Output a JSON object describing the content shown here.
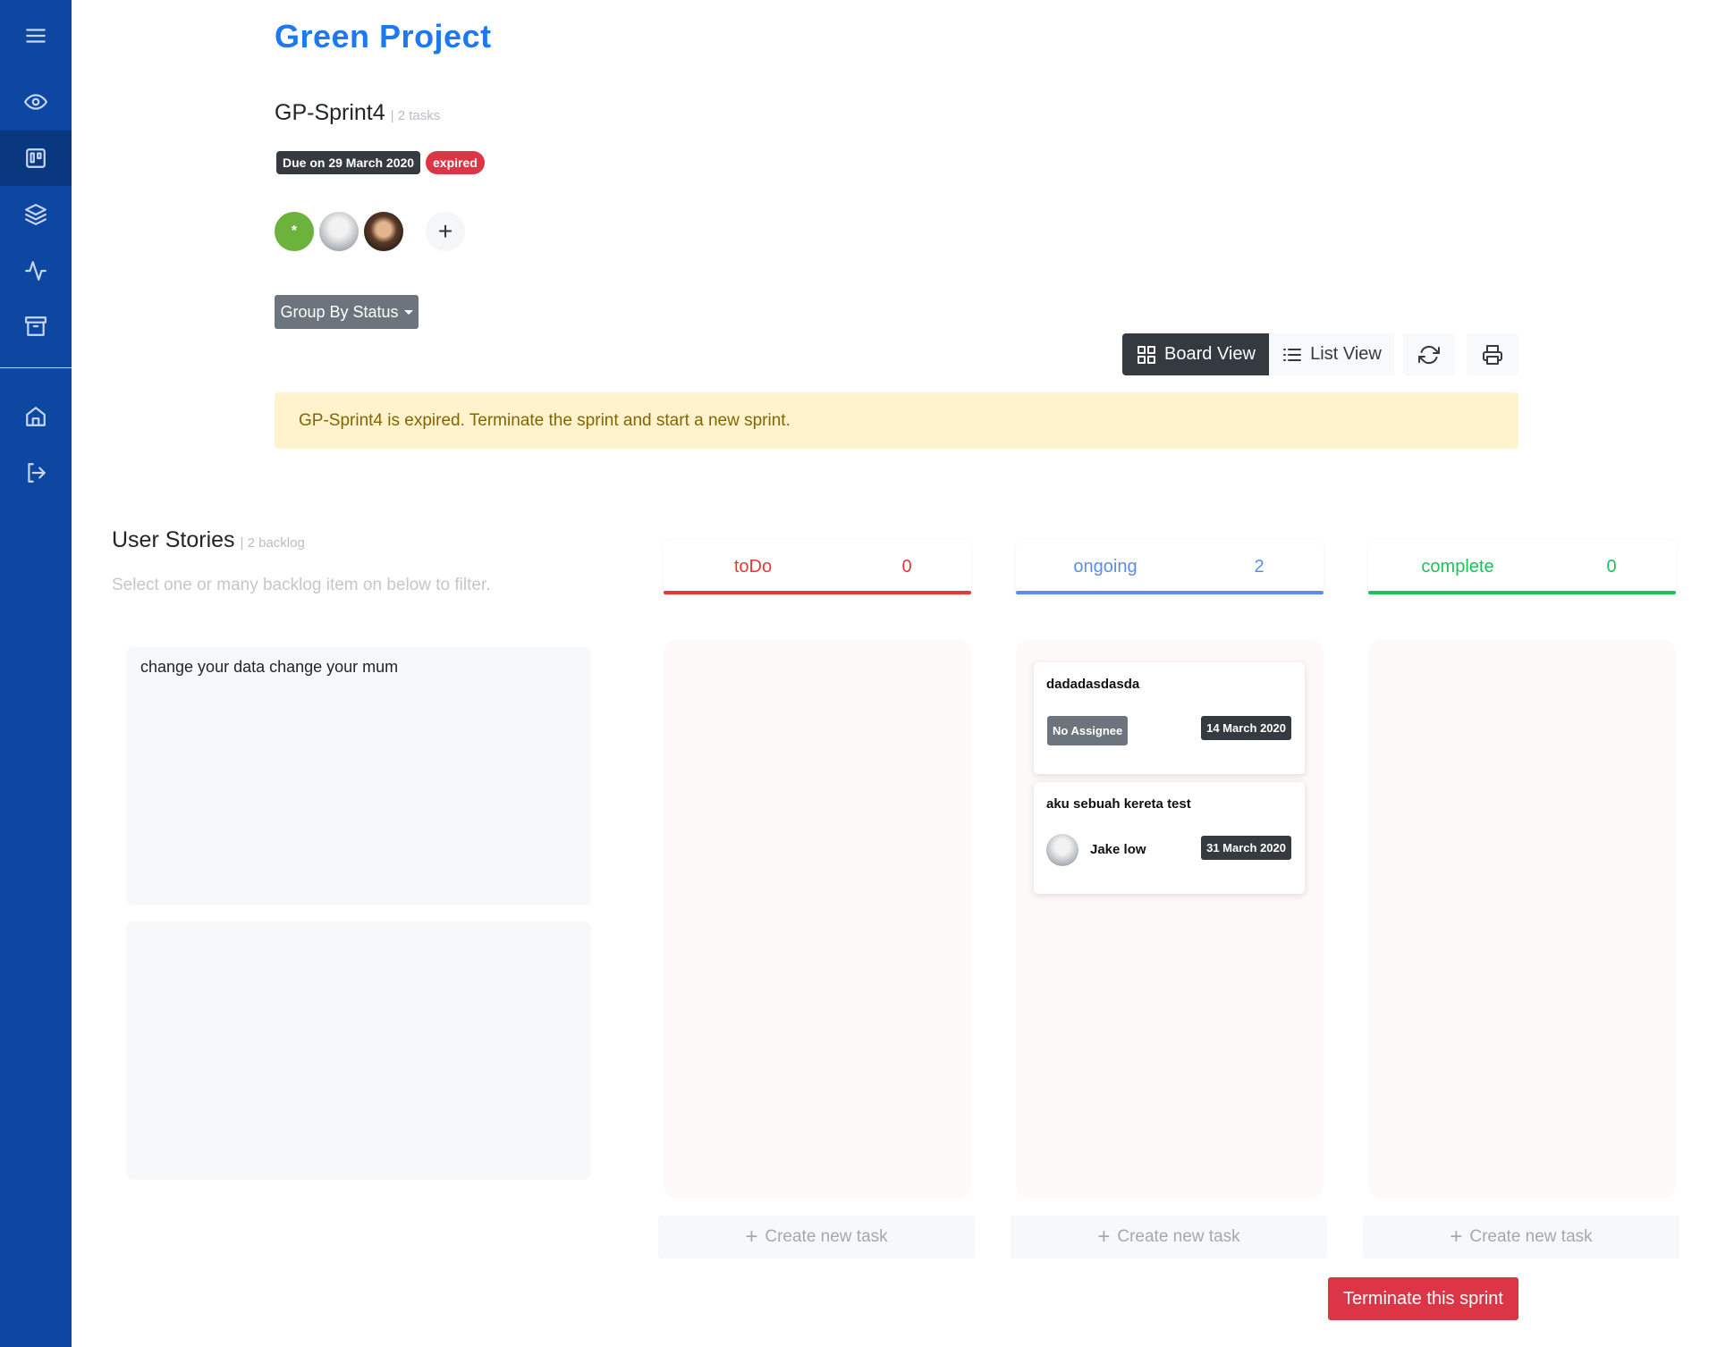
{
  "sidebar": {
    "items": [
      {
        "icon": "menu-icon"
      },
      {
        "icon": "eye-icon"
      },
      {
        "icon": "kanban-board-icon",
        "active": true
      },
      {
        "icon": "layers-icon"
      },
      {
        "icon": "activity-icon"
      },
      {
        "icon": "archive-icon"
      },
      {
        "icon": "home-icon"
      },
      {
        "icon": "logout-icon"
      }
    ],
    "background": "#0d47a1"
  },
  "header": {
    "project_title": "Green Project",
    "sprint_name": "GP-Sprint4",
    "sprint_task_count": "| 2 tasks",
    "due_badge": "Due on 29 March 2020",
    "status_badge": "expired",
    "members": [
      {
        "type": "initial",
        "label": "*"
      },
      {
        "type": "photo"
      },
      {
        "type": "photo"
      }
    ],
    "add_member": "+"
  },
  "group_by": {
    "label": "Group By Status"
  },
  "toolbar": {
    "board_view": "Board View",
    "list_view": "List View",
    "refresh_icon": "refresh-icon",
    "print_icon": "printer-icon"
  },
  "alert": {
    "text": "GP-Sprint4 is expired. Terminate the sprint and start a new sprint."
  },
  "user_stories": {
    "title": "User Stories",
    "count": "| 2 backlog",
    "hint": "Select one or many backlog item on below to filter.",
    "items": [
      {
        "text": "change your data change your mum"
      },
      {
        "text": ""
      }
    ]
  },
  "columns": [
    {
      "name": "toDo",
      "count": "0",
      "color": "#e53935"
    },
    {
      "name": "ongoing",
      "count": "2",
      "color": "#5b8def"
    },
    {
      "name": "complete",
      "count": "0",
      "color": "#1fbf5b"
    }
  ],
  "tasks": [
    {
      "name": "dadadasdasda",
      "assignee": "No Assignee",
      "date": "14 March 2020"
    },
    {
      "name": "aku sebuah kereta test",
      "assignee": "Jake low",
      "date": "31 March 2020"
    }
  ],
  "create_task": {
    "label": "Create new task",
    "icon": "+"
  },
  "terminate": {
    "label": "Terminate this sprint"
  }
}
